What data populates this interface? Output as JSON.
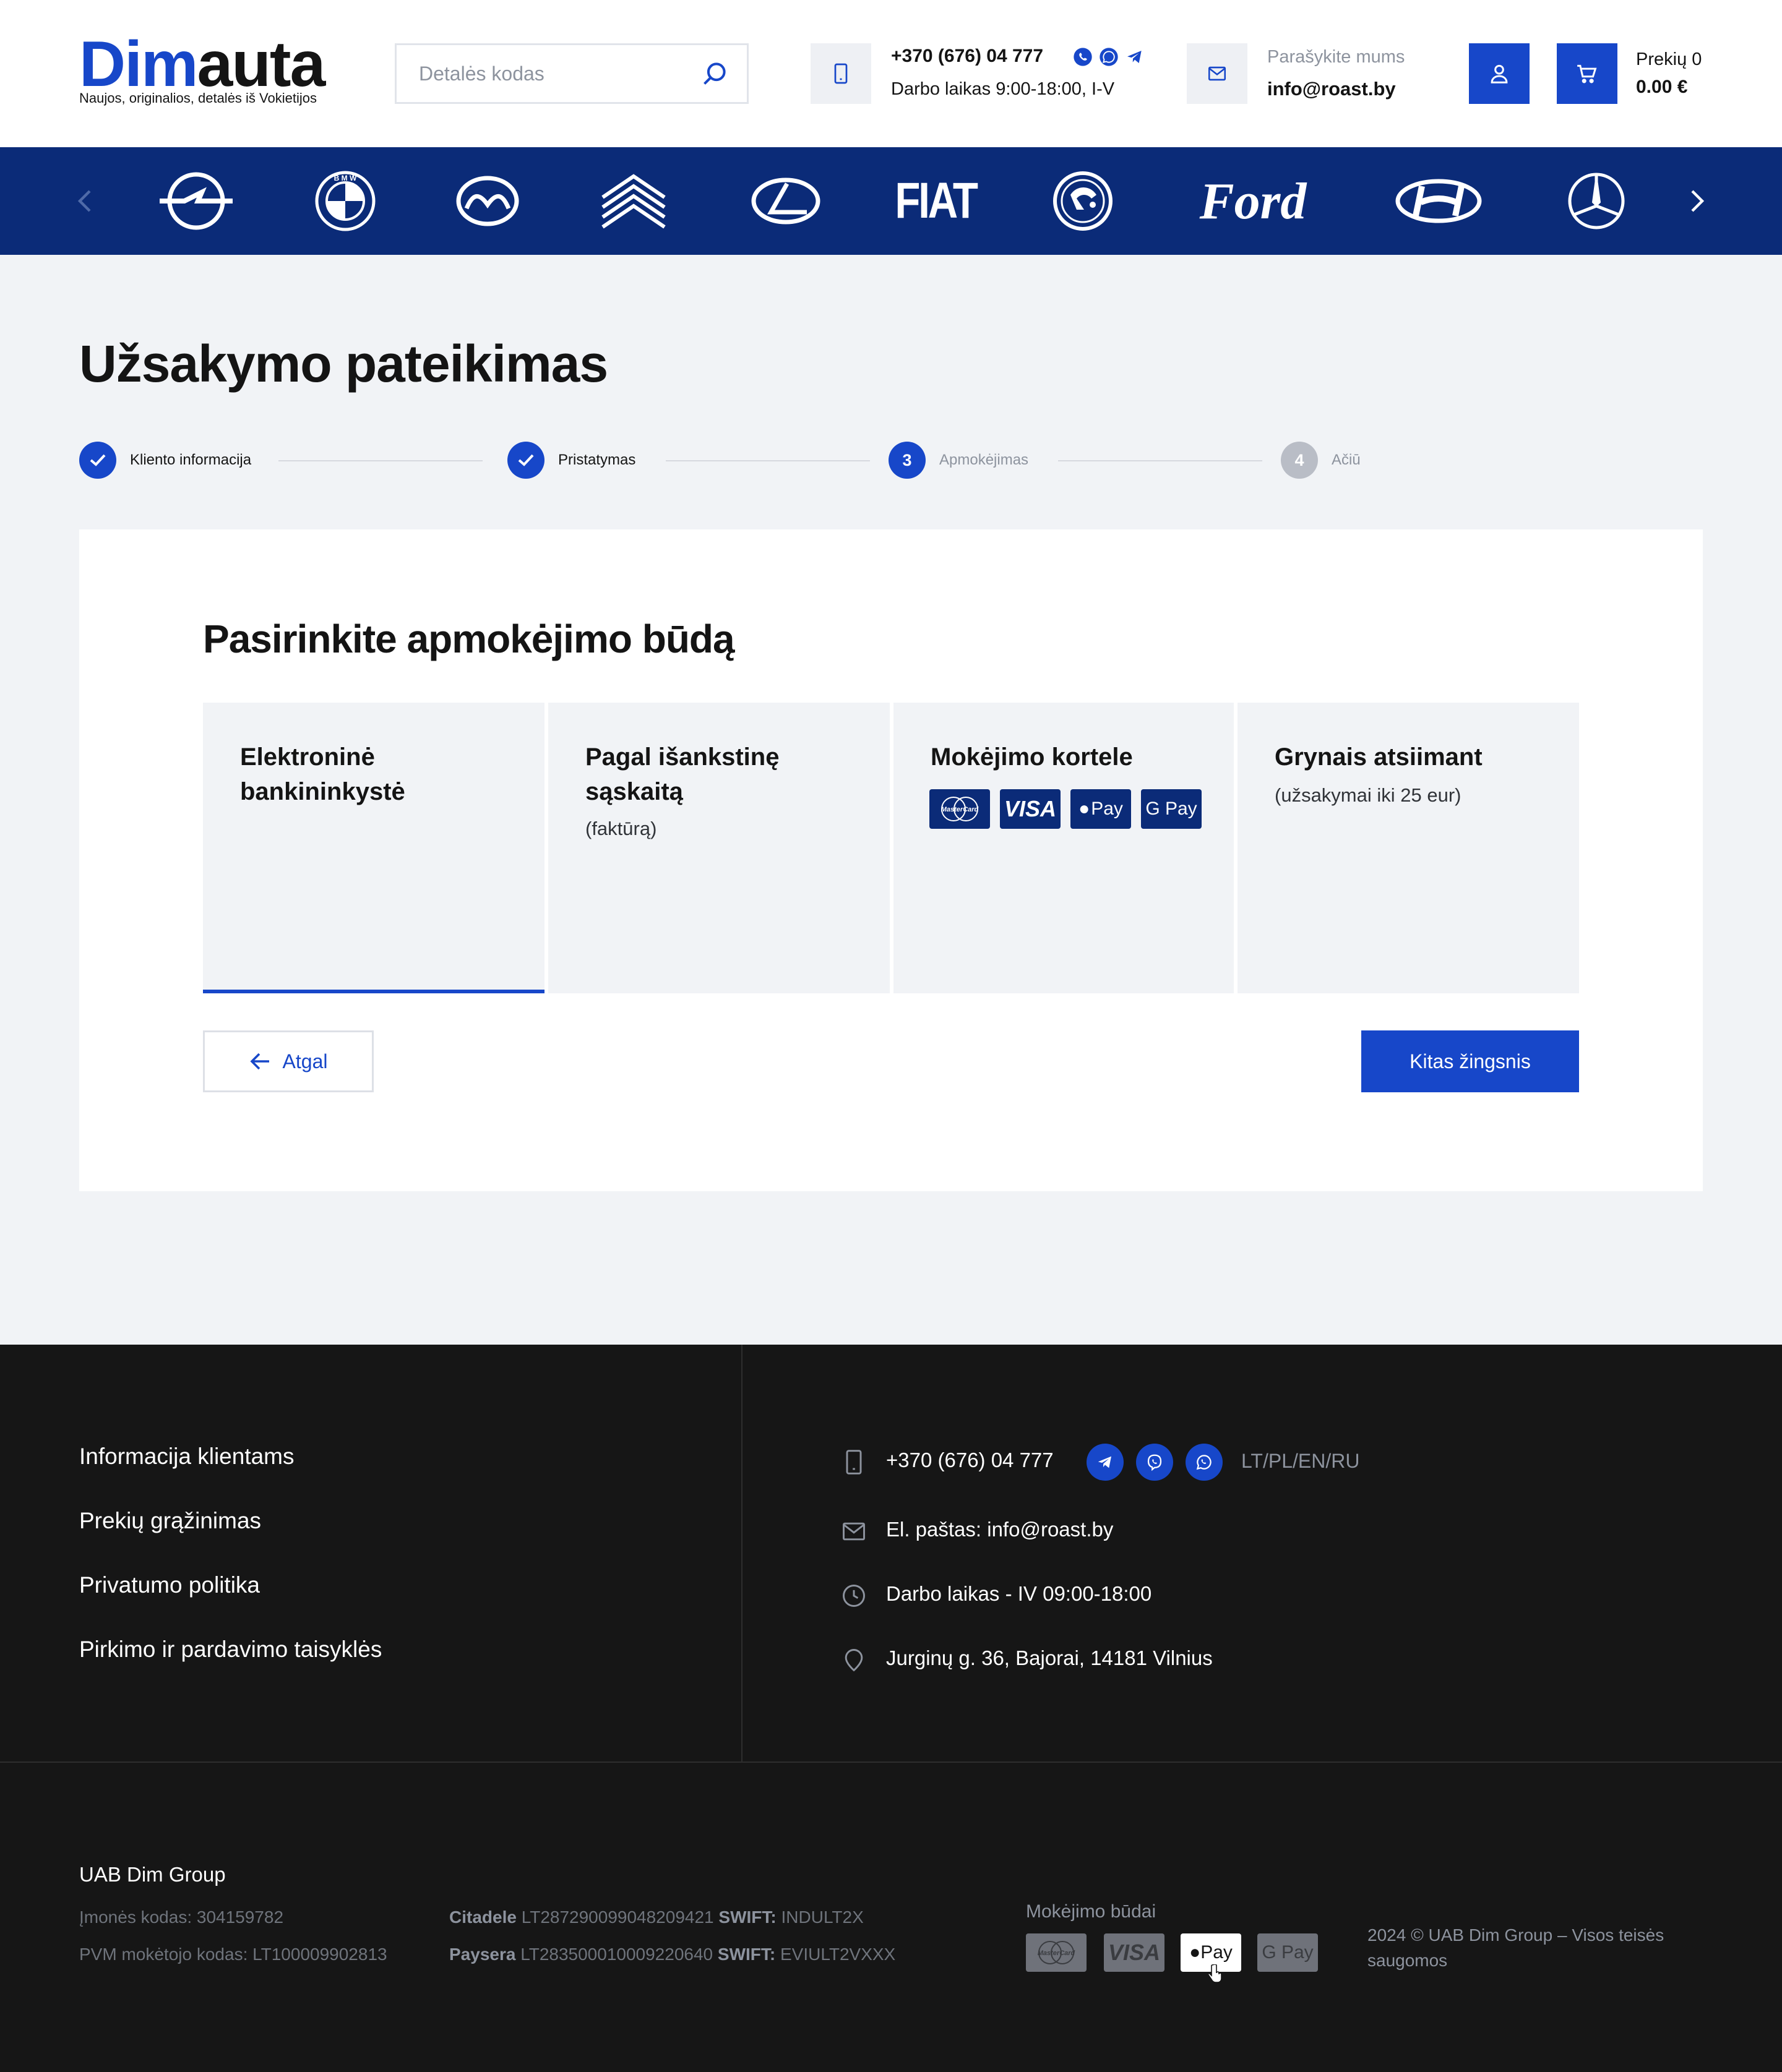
{
  "header": {
    "logo": {
      "part1": "Dim",
      "part2": "auta",
      "tagline": "Naujos, originalios, detalės iš Vokietijos"
    },
    "search": {
      "placeholder": "Detalės kodas"
    },
    "phone": "+370 (676) 04 777",
    "hours": "Darbo laikas 9:00-18:00, I-V",
    "write_us": "Parašykite mums",
    "email": "info@roast.by",
    "cart": {
      "count_label": "Prekių 0",
      "total": "0.00 €"
    }
  },
  "brands": [
    "Opel",
    "BMW",
    "Mazda",
    "Citroën",
    "Lexus",
    "FIAT",
    "Škoda",
    "Ford",
    "Hyundai",
    "Mercedes-Benz"
  ],
  "brand_labels": {
    "fiat": "FIAT",
    "ford": "Ford",
    "bmw": "B M W"
  },
  "page": {
    "title": "Užsakymo pateikimas",
    "steps": [
      {
        "label": "Kliento informacija",
        "state": "done"
      },
      {
        "label": "Pristatymas",
        "state": "done"
      },
      {
        "label": "Apmokėjimas",
        "state": "current",
        "number": "3"
      },
      {
        "label": "Ačiū",
        "state": "pending",
        "number": "4"
      }
    ]
  },
  "payment": {
    "title": "Pasirinkite apmokėjimo būdą",
    "options": [
      {
        "title_line1": "Elektroninė",
        "title_line2": "bankininkystė",
        "note": "",
        "selected": true
      },
      {
        "title_line1": "Pagal išankstinę",
        "title_line2": "sąskaitą",
        "note": "(faktūrą)",
        "selected": false
      },
      {
        "title_line1": "Mokėjimo kortele",
        "title_line2": "",
        "note": "",
        "selected": false
      },
      {
        "title_line1": "Grynais atsiimant",
        "title_line2": "",
        "note": "(užsakymai iki 25 eur)",
        "selected": false
      }
    ],
    "card_badges": [
      "MasterCard",
      "VISA",
      "Pay",
      "G Pay"
    ],
    "back_label": "Atgal",
    "next_label": "Kitas žingsnis"
  },
  "footer": {
    "links": [
      "Informacija klientams",
      "Prekių grąžinimas",
      "Privatumo politika",
      "Pirkimo ir pardavimo taisyklės"
    ],
    "phone": "+370 (676) 04 777",
    "languages": "LT/PL/EN/RU",
    "email": "El. paštas: info@roast.by",
    "hours": "Darbo laikas - IV 09:00-18:00",
    "address": "Jurginų g. 36, Bajorai, 14181 Vilnius",
    "company": "UAB Dim Group",
    "company_code": "Įmonės kodas: 304159782",
    "vat_code": "PVM mokėtojo kodas: LT100009902813",
    "bank1": {
      "name": "Citadele",
      "iban": " LT287290099048209421 ",
      "swift_label": "SWIFT:",
      "swift": " INDULT2X"
    },
    "bank2": {
      "name": "Paysera",
      "iban": " LT283500010009220640 ",
      "swift_label": "SWIFT:",
      "swift": " EVIULT2VXXX"
    },
    "payment_methods_label": "Mokėjimo būdai",
    "payment_methods": [
      "MasterCard",
      "VISA",
      "Pay",
      "G Pay"
    ],
    "copyright": "2024 © UAB Dim Group – Visos teisės saugomos"
  },
  "colors": {
    "accent": "#1747c9",
    "navy": "#0b2b78",
    "footer_bg": "#161616",
    "page_bg": "#f1f3f6",
    "step_pending": "#b9bdc6"
  }
}
